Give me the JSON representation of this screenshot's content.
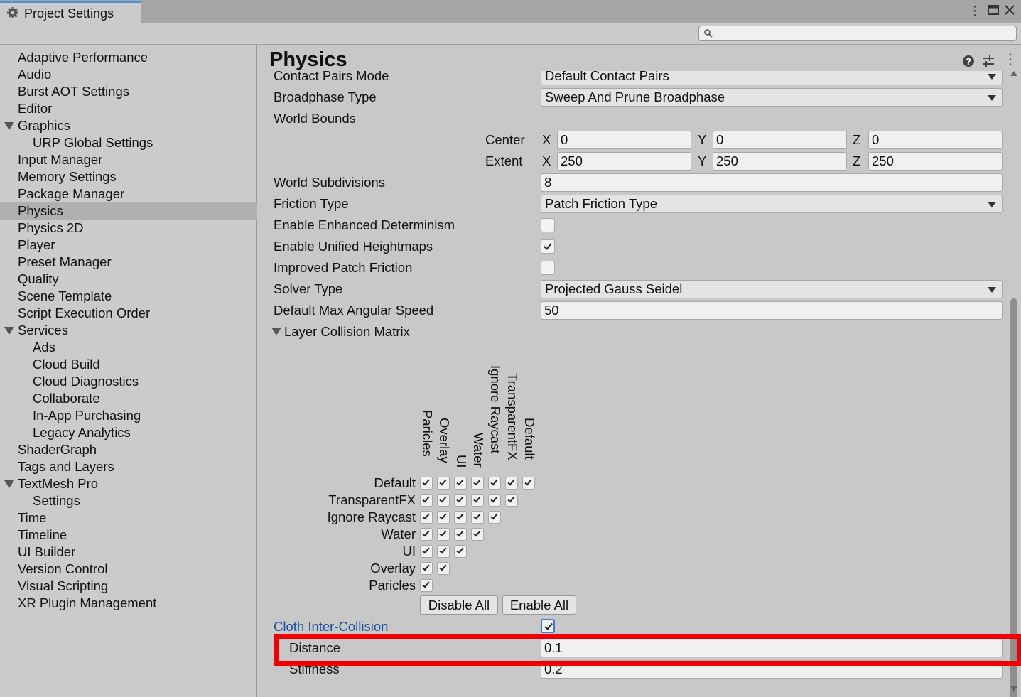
{
  "window": {
    "tab_title": "Project Settings",
    "icons": [
      "gear-icon",
      "more-vert-icon",
      "maximize-icon",
      "close-icon"
    ]
  },
  "search": {
    "placeholder": "",
    "value": ""
  },
  "sidebar": {
    "items": [
      {
        "label": "Adaptive Performance"
      },
      {
        "label": "Audio"
      },
      {
        "label": "Burst AOT Settings"
      },
      {
        "label": "Editor"
      },
      {
        "label": "Graphics"
      },
      {
        "label": "URP Global Settings"
      },
      {
        "label": "Input Manager"
      },
      {
        "label": "Memory Settings"
      },
      {
        "label": "Package Manager"
      },
      {
        "label": "Physics"
      },
      {
        "label": "Physics 2D"
      },
      {
        "label": "Player"
      },
      {
        "label": "Preset Manager"
      },
      {
        "label": "Quality"
      },
      {
        "label": "Scene Template"
      },
      {
        "label": "Script Execution Order"
      },
      {
        "label": "Services"
      },
      {
        "label": "Ads"
      },
      {
        "label": "Cloud Build"
      },
      {
        "label": "Cloud Diagnostics"
      },
      {
        "label": "Collaborate"
      },
      {
        "label": "In-App Purchasing"
      },
      {
        "label": "Legacy Analytics"
      },
      {
        "label": "ShaderGraph"
      },
      {
        "label": "Tags and Layers"
      },
      {
        "label": "TextMesh Pro"
      },
      {
        "label": "Settings"
      },
      {
        "label": "Time"
      },
      {
        "label": "Timeline"
      },
      {
        "label": "UI Builder"
      },
      {
        "label": "Version Control"
      },
      {
        "label": "Visual Scripting"
      },
      {
        "label": "XR Plugin Management"
      }
    ],
    "selected": "Physics"
  },
  "main": {
    "title": "Physics",
    "header_icons": [
      "help-icon",
      "preset-sliders-icon",
      "more-vert-icon"
    ],
    "contact_pairs_mode": {
      "label": "Contact Pairs Mode",
      "value": "Default Contact Pairs"
    },
    "broadphase_type": {
      "label": "Broadphase Type",
      "value": "Sweep And Prune Broadphase"
    },
    "world_bounds": {
      "label": "World Bounds",
      "center_label": "Center",
      "extent_label": "Extent",
      "axis_x": "X",
      "axis_y": "Y",
      "axis_z": "Z",
      "center": {
        "x": "0",
        "y": "0",
        "z": "0"
      },
      "extent": {
        "x": "250",
        "y": "250",
        "z": "250"
      }
    },
    "world_subdivisions": {
      "label": "World Subdivisions",
      "value": "8"
    },
    "friction_type": {
      "label": "Friction Type",
      "value": "Patch Friction Type"
    },
    "enhanced_determinism": {
      "label": "Enable Enhanced Determinism",
      "checked": false
    },
    "unified_heightmaps": {
      "label": "Enable Unified Heightmaps",
      "checked": true
    },
    "improved_patch_friction": {
      "label": "Improved Patch Friction",
      "checked": false
    },
    "solver_type": {
      "label": "Solver Type",
      "value": "Projected Gauss Seidel"
    },
    "max_angular_speed": {
      "label": "Default Max Angular Speed",
      "value": "50"
    },
    "layer_collision_matrix": {
      "label": "Layer Collision Matrix",
      "layers": [
        "Default",
        "TransparentFX",
        "Ignore Raycast",
        "Water",
        "UI",
        "Overlay",
        "Paricles"
      ],
      "columns": [
        "Paricles",
        "Overlay",
        "UI",
        "Water",
        "Ignore Raycast",
        "TransparentFX",
        "Default"
      ],
      "all_checked": true,
      "disable_all": "Disable All",
      "enable_all": "Enable All"
    },
    "cloth_inter_collision": {
      "label": "Cloth Inter-Collision",
      "checked": true
    },
    "distance": {
      "label": "Distance",
      "value": "0.1"
    },
    "stiffness": {
      "label": "Stiffness",
      "value": "0.2"
    }
  },
  "colors": {
    "highlight": "#f00000",
    "link_label": "#1a4fa0",
    "selection": "#b0b0b0"
  }
}
